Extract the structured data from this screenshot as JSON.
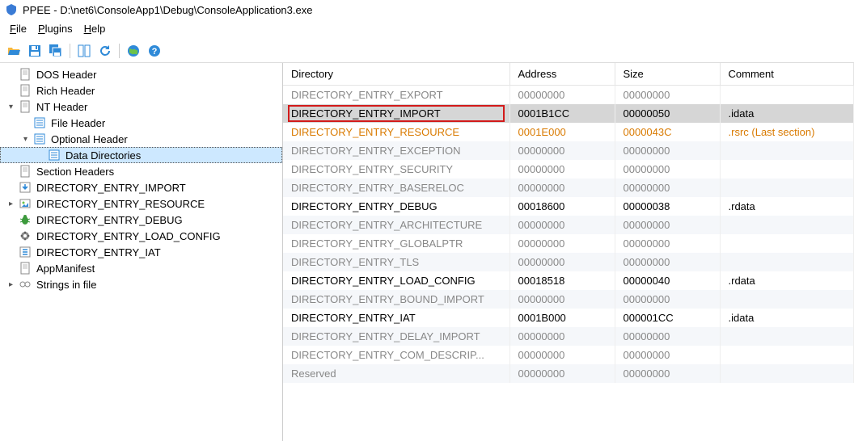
{
  "titlebar": {
    "app_name": "PPEE",
    "path": "D:\\net6\\ConsoleApp1\\Debug\\ConsoleApplication3.exe"
  },
  "menu": {
    "file": "File",
    "plugins": "Plugins",
    "help": "Help"
  },
  "tree": [
    {
      "level": 0,
      "icon": "page",
      "label": "DOS Header"
    },
    {
      "level": 0,
      "icon": "page",
      "label": "Rich Header"
    },
    {
      "level": 0,
      "icon": "page",
      "label": "NT Header",
      "expander": "open"
    },
    {
      "level": 1,
      "icon": "list",
      "label": "File Header"
    },
    {
      "level": 1,
      "icon": "list",
      "label": "Optional Header",
      "expander": "open"
    },
    {
      "level": 2,
      "icon": "list",
      "label": "Data Directories",
      "selected": true
    },
    {
      "level": 0,
      "icon": "page",
      "label": "Section Headers"
    },
    {
      "level": 0,
      "icon": "imp",
      "label": "DIRECTORY_ENTRY_IMPORT"
    },
    {
      "level": 0,
      "icon": "res",
      "label": "DIRECTORY_ENTRY_RESOURCE",
      "expander": "closed"
    },
    {
      "level": 0,
      "icon": "bug",
      "label": "DIRECTORY_ENTRY_DEBUG"
    },
    {
      "level": 0,
      "icon": "cfg",
      "label": "DIRECTORY_ENTRY_LOAD_CONFIG"
    },
    {
      "level": 0,
      "icon": "iat",
      "label": "DIRECTORY_ENTRY_IAT"
    },
    {
      "level": 0,
      "icon": "page",
      "label": "AppManifest"
    },
    {
      "level": 0,
      "icon": "str",
      "label": "Strings in file",
      "expander": "closed"
    }
  ],
  "table": {
    "headers": {
      "dir": "Directory",
      "addr": "Address",
      "size": "Size",
      "comment": "Comment"
    },
    "rows": [
      {
        "dir": "DIRECTORY_ENTRY_EXPORT",
        "addr": "00000000",
        "size": "00000000",
        "comment": ""
      },
      {
        "dir": "DIRECTORY_ENTRY_IMPORT",
        "addr": "0001B1CC",
        "size": "00000050",
        "comment": ".idata",
        "sel": true,
        "strong": true,
        "alt": true
      },
      {
        "dir": "DIRECTORY_ENTRY_RESOURCE",
        "addr": "0001E000",
        "size": "0000043C",
        "comment": ".rsrc (Last section)",
        "orange": true
      },
      {
        "dir": "DIRECTORY_ENTRY_EXCEPTION",
        "addr": "00000000",
        "size": "00000000",
        "comment": "",
        "alt": true
      },
      {
        "dir": "DIRECTORY_ENTRY_SECURITY",
        "addr": "00000000",
        "size": "00000000",
        "comment": ""
      },
      {
        "dir": "DIRECTORY_ENTRY_BASERELOC",
        "addr": "00000000",
        "size": "00000000",
        "comment": "",
        "alt": true
      },
      {
        "dir": "DIRECTORY_ENTRY_DEBUG",
        "addr": "00018600",
        "size": "00000038",
        "comment": ".rdata",
        "strong": true
      },
      {
        "dir": "DIRECTORY_ENTRY_ARCHITECTURE",
        "addr": "00000000",
        "size": "00000000",
        "comment": "",
        "alt": true
      },
      {
        "dir": "DIRECTORY_ENTRY_GLOBALPTR",
        "addr": "00000000",
        "size": "00000000",
        "comment": ""
      },
      {
        "dir": "DIRECTORY_ENTRY_TLS",
        "addr": "00000000",
        "size": "00000000",
        "comment": "",
        "alt": true
      },
      {
        "dir": "DIRECTORY_ENTRY_LOAD_CONFIG",
        "addr": "00018518",
        "size": "00000040",
        "comment": ".rdata",
        "strong": true
      },
      {
        "dir": "DIRECTORY_ENTRY_BOUND_IMPORT",
        "addr": "00000000",
        "size": "00000000",
        "comment": "",
        "alt": true
      },
      {
        "dir": "DIRECTORY_ENTRY_IAT",
        "addr": "0001B000",
        "size": "000001CC",
        "comment": ".idata",
        "strong": true
      },
      {
        "dir": "DIRECTORY_ENTRY_DELAY_IMPORT",
        "addr": "00000000",
        "size": "00000000",
        "comment": "",
        "alt": true
      },
      {
        "dir": "DIRECTORY_ENTRY_COM_DESCRIP...",
        "addr": "00000000",
        "size": "00000000",
        "comment": ""
      },
      {
        "dir": "Reserved",
        "addr": "00000000",
        "size": "00000000",
        "comment": "",
        "alt": true
      }
    ]
  }
}
